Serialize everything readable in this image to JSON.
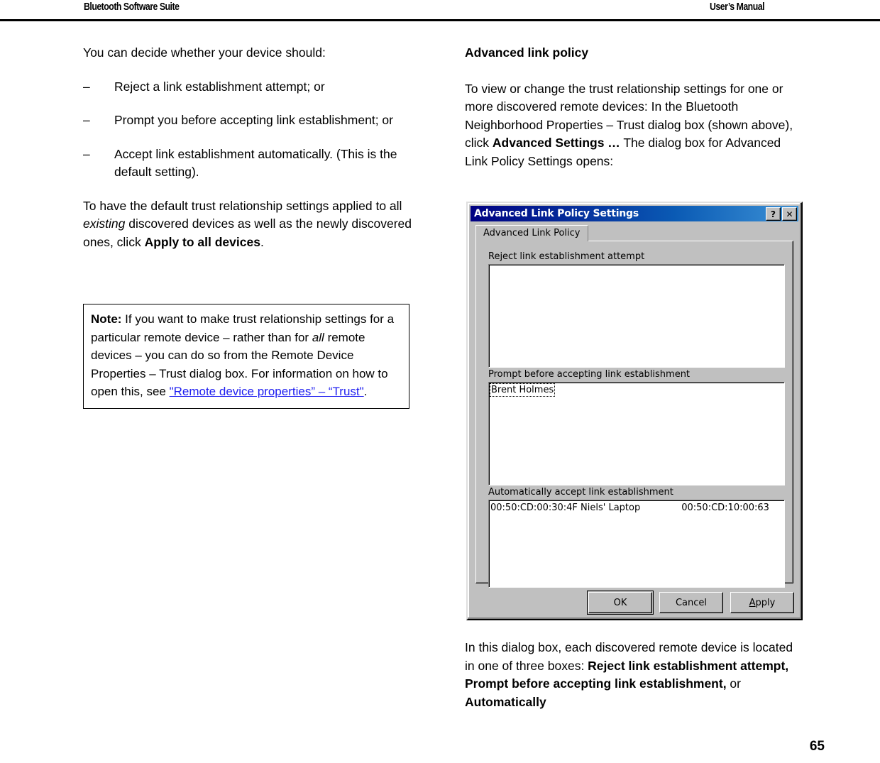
{
  "header": {
    "left_title": "Bluetooth Software Suite",
    "right_title": "User’s Manual"
  },
  "left_column": {
    "intro": "You can decide whether your device should:",
    "dash_glyph": "–",
    "bullets": [
      "Reject a link establishment attempt; or",
      "Prompt you before accepting link establishment; or",
      "Accept link establishment automatically. (This is the default setting)."
    ],
    "paragraph_pre": "To have the default trust relationship settings applied to all ",
    "paragraph_italic": "existing",
    "paragraph_mid": " discovered devices as well as the newly discovered ones, click ",
    "paragraph_bold": "Apply to all devices",
    "paragraph_post": ".",
    "note": {
      "label": "Note:",
      "text_1": " If you want to make trust relationship settings for a particular remote device – rather than for ",
      "italic_1": "all",
      "text_2": " remote devices – you can do so from the Remote Device Properties – Trust dialog box. For information on how to open this, see ",
      "link": "\"Remote device properties” – “Trust\"",
      "text_3": "."
    }
  },
  "right_column": {
    "heading": "Advanced link policy",
    "paragraph_pre": "To view or change the trust relationship settings for one or more discovered remote devices: In the Bluetooth Neighborhood Properties – Trust dialog box (shown above), click ",
    "paragraph_bold": "Advanced Settings …",
    "paragraph_post": " The dialog box for Advanced Link Policy Settings opens:",
    "closing": {
      "pre": "In this dialog box, each discovered remote device is located in one of three boxes: ",
      "bold_1": "Reject link establishment attempt, Prompt before accepting link establishment,",
      "mid": " or ",
      "bold_2": "Automatically"
    }
  },
  "dialog": {
    "title": "Advanced Link Policy Settings",
    "help_button": "?",
    "close_button": "✕",
    "tab_label": "Advanced Link Policy",
    "groups": [
      {
        "label": "Reject link establishment attempt",
        "rows": []
      },
      {
        "label": "Prompt before accepting link establishment",
        "rows": [
          {
            "col1": "Brent Holmes",
            "col2": "",
            "focused": true
          }
        ]
      },
      {
        "label": "Automatically accept link establishment",
        "rows": [
          {
            "col1": "00:50:CD:00:30:4F  Niels' Laptop",
            "col2": "00:50:CD:10:00:63",
            "focused": false
          }
        ]
      }
    ],
    "buttons": {
      "ok": "OK",
      "cancel": "Cancel",
      "apply_accesskey": "A",
      "apply_rest": "pply"
    }
  },
  "footer": {
    "page_number": "65"
  },
  "colors": {
    "link": "#1d1df0",
    "titlebar_start": "#000082",
    "titlebar_end": "#3d92d6",
    "dialog_face": "#c0c0c0"
  }
}
